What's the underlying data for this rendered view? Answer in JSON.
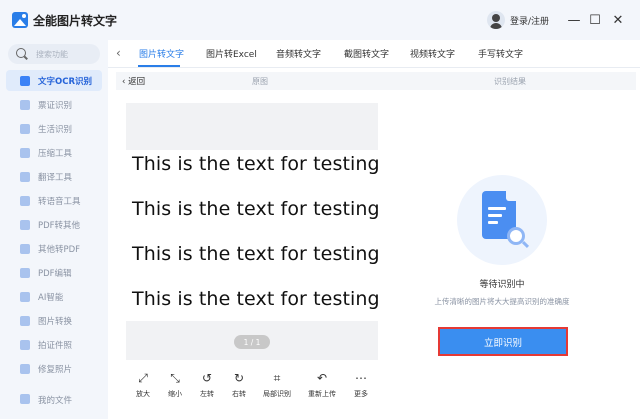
{
  "app": {
    "title": "全能图片转文字",
    "login_label": "登录/注册",
    "window_controls": {
      "minimize": "—",
      "maximize": "☐",
      "close": "✕"
    }
  },
  "sidebar": {
    "search_placeholder": "搜索功能",
    "items": [
      {
        "label": "文字OCR识别",
        "active": true
      },
      {
        "label": "票证识别"
      },
      {
        "label": "生活识别"
      },
      {
        "label": "压缩工具"
      },
      {
        "label": "翻译工具"
      },
      {
        "label": "转语音工具"
      },
      {
        "label": "PDF转其他"
      },
      {
        "label": "其他转PDF"
      },
      {
        "label": "PDF编辑"
      },
      {
        "label": "AI智能"
      },
      {
        "label": "图片转换"
      },
      {
        "label": "拍证件照"
      },
      {
        "label": "修复照片"
      }
    ],
    "my_files": "我的文件"
  },
  "tabs": {
    "back_glyph": "‹",
    "items": [
      {
        "label": "图片转文字",
        "active": true
      },
      {
        "label": "图片转Excel"
      },
      {
        "label": "音频转文字"
      },
      {
        "label": "截图转文字"
      },
      {
        "label": "视频转文字"
      },
      {
        "label": "手写转文字"
      }
    ]
  },
  "subheader": {
    "back": "‹ 返回",
    "original": "原图",
    "result": "识别结果"
  },
  "preview": {
    "lines": [
      "This is the text for testing.",
      "This is the text for testing.",
      "This is the text for testing.",
      "This is the text for testing."
    ],
    "page_indicator": "1 / 1"
  },
  "toolbar": [
    {
      "icon": "expand-icon",
      "glyph": "⤢",
      "label": "放大"
    },
    {
      "icon": "shrink-icon",
      "glyph": "⤡",
      "label": "缩小"
    },
    {
      "icon": "rotate-left-icon",
      "glyph": "↺",
      "label": "左转"
    },
    {
      "icon": "rotate-right-icon",
      "glyph": "↻",
      "label": "右转"
    },
    {
      "icon": "crop-icon",
      "glyph": "⌗",
      "label": "局部识别"
    },
    {
      "icon": "reupload-icon",
      "glyph": "↶",
      "label": "重新上传"
    },
    {
      "icon": "more-icon",
      "glyph": "⋯",
      "label": "更多"
    }
  ],
  "result": {
    "status": "等待识别中",
    "hint": "上传清晰的图片将大大提高识别的准确度",
    "button": "立即识别"
  },
  "colors": {
    "accent": "#2a7ee8",
    "button": "#3a8ef0",
    "highlight_border": "#e53935"
  }
}
